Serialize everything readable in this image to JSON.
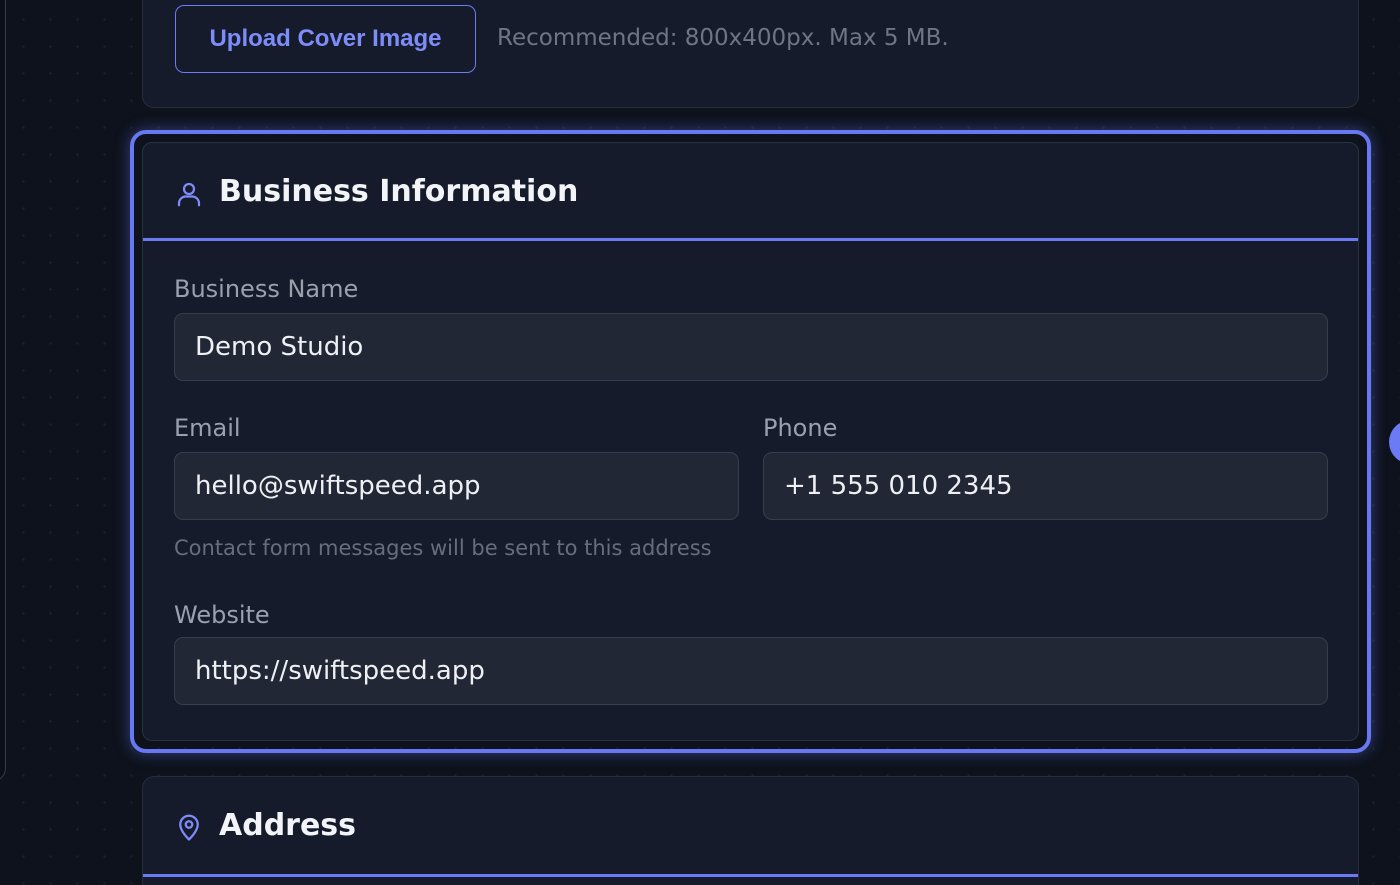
{
  "cover": {
    "upload_button": "Upload Cover Image",
    "hint": "Recommended: 800x400px. Max 5 MB."
  },
  "business_info": {
    "title": "Business Information",
    "icon": "user-icon",
    "fields": {
      "business_name": {
        "label": "Business Name",
        "value": "Demo Studio"
      },
      "email": {
        "label": "Email",
        "value": "hello@swiftspeed.app",
        "help": "Contact form messages will be sent to this address"
      },
      "phone": {
        "label": "Phone",
        "value": "+1 555 010 2345"
      },
      "website": {
        "label": "Website",
        "value": "https://swiftspeed.app"
      }
    }
  },
  "address": {
    "title": "Address",
    "icon": "map-pin-icon"
  },
  "colors": {
    "accent": "#6a7af4",
    "background": "#0d121c",
    "card": "#151b2a",
    "input": "#212735"
  }
}
